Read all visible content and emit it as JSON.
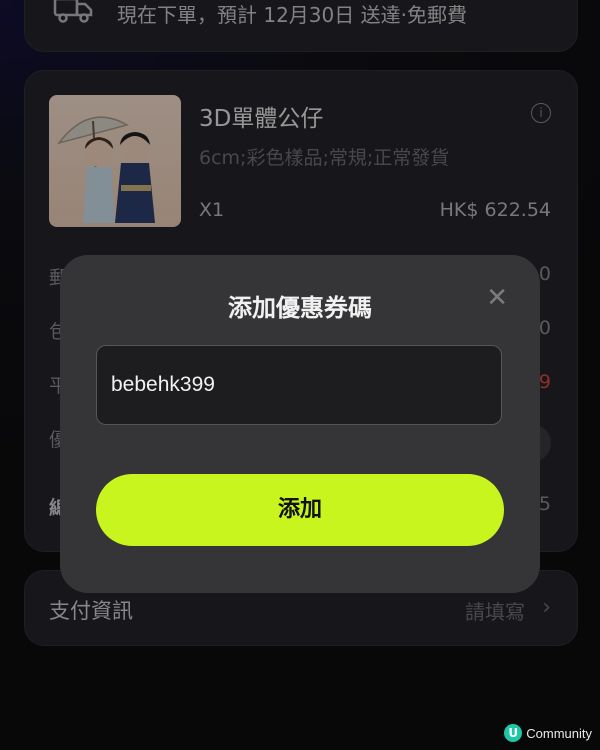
{
  "shipping": {
    "text": "現在下單，預計 12月30日 送達·免郵費"
  },
  "product": {
    "name": "3D單體公仔",
    "variant": "6cm;彩色樣品;常規;正常發貨",
    "quantity": "X1",
    "price": "HK$ 622.54"
  },
  "summary_fragments": {
    "r1_left": "郵",
    "r1_right": "0",
    "r2_left": "包",
    "r2_right": "0",
    "r3_left": "平",
    "r3_right": "9",
    "r4_left": "優",
    "r5_left": "總",
    "r5_right": "5"
  },
  "payment": {
    "label": "支付資訊",
    "value": "請填寫"
  },
  "modal": {
    "title": "添加優惠券碼",
    "coupon_value": "bebehk399",
    "add_label": "添加"
  },
  "watermark": {
    "logo": "U",
    "text": "Community"
  },
  "colors": {
    "accent": "#c8f51e",
    "discount_red": "#d9493a"
  }
}
